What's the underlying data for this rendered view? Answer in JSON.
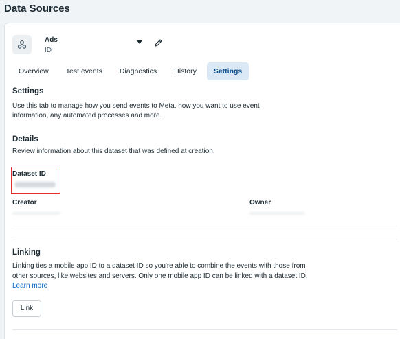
{
  "page": {
    "title": "Data Sources"
  },
  "dataset": {
    "name": "Ads",
    "id_label": "ID"
  },
  "tabs": [
    {
      "label": "Overview",
      "active": false
    },
    {
      "label": "Test events",
      "active": false
    },
    {
      "label": "Diagnostics",
      "active": false
    },
    {
      "label": "History",
      "active": false
    },
    {
      "label": "Settings",
      "active": true
    }
  ],
  "settings": {
    "heading": "Settings",
    "description_line1": "Use this tab to manage how you send events to Meta, how you want to use event",
    "description_line2": "information, any automated processes and more."
  },
  "details": {
    "heading": "Details",
    "description": "Review information about this dataset that was defined at creation.",
    "dataset_id_label": "Dataset ID",
    "creator_label": "Creator",
    "owner_label": "Owner"
  },
  "linking": {
    "heading": "Linking",
    "line1": "Linking ties a mobile app ID to a dataset ID so you're able to combine the events with those from",
    "line2": "other sources, like websites and servers. Only one mobile app ID can be linked with a dataset ID.",
    "learn_more": "Learn more",
    "button_label": "Link"
  }
}
